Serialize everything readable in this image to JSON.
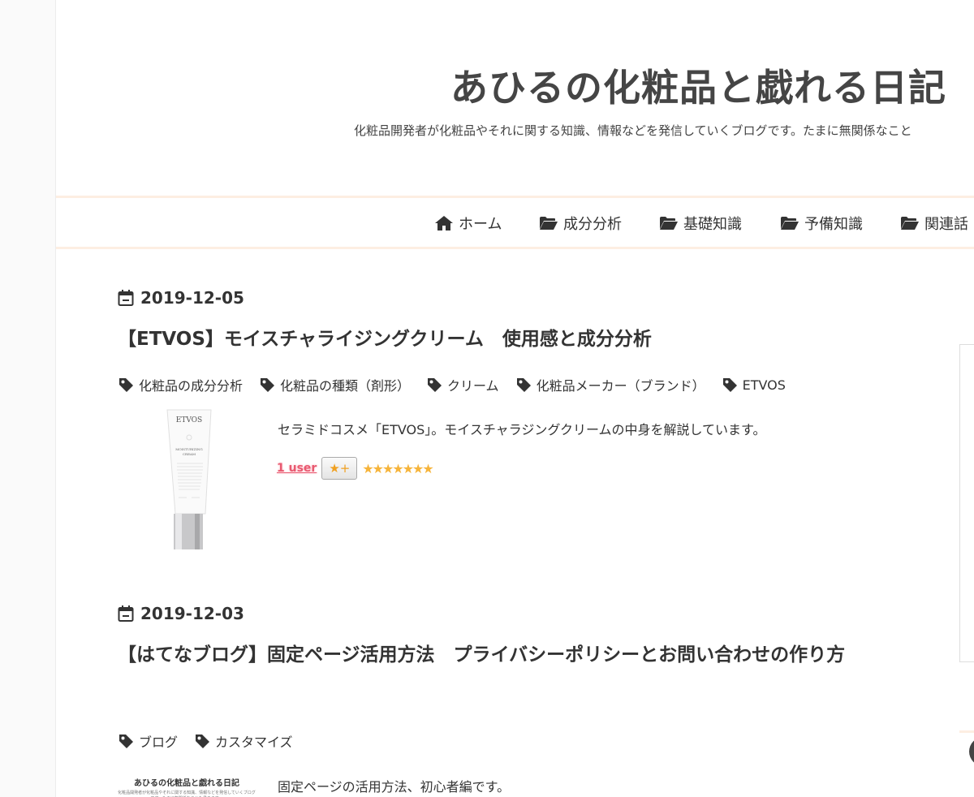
{
  "site": {
    "title": "あひるの化粧品と戯れる日記",
    "description": "化粧品開発者が化粧品やそれに関する知識、情報などを発信していくブログです。たまに無関係なこと"
  },
  "nav": [
    {
      "label": "ホーム",
      "icon": "home-icon"
    },
    {
      "label": "成分分析",
      "icon": "folder-open-icon"
    },
    {
      "label": "基礎知識",
      "icon": "folder-open-icon"
    },
    {
      "label": "予備知識",
      "icon": "folder-open-icon"
    },
    {
      "label": "関連話",
      "icon": "folder-open-icon"
    }
  ],
  "entries": [
    {
      "date": "2019-12-05",
      "title": "【ETVOS】モイスチャライジングクリーム　使用感と成分分析",
      "tags": [
        "化粧品の成分分析",
        "化粧品の種類（剤形）",
        "クリーム",
        "化粧品メーカー（ブランド）",
        "ETVOS"
      ],
      "summary": "セラミドコスメ「ETVOS」。モイスチャラジングクリームの中身を解説しています。",
      "bookmark_users": "1 user",
      "add_star": "★+",
      "stars": "★★★★★★★",
      "thumbnail": {
        "brand": "ETVOS",
        "sub": "MOISTURIZING",
        "product": "CREAM"
      }
    },
    {
      "date": "2019-12-03",
      "title": "【はてなブログ】固定ページ活用方法　プライバシーポリシーとお問い合わせの作り方",
      "tags": [
        "ブログ",
        "カスタマイズ"
      ],
      "summary": "固定ページの活用方法、初心者編です。",
      "thumbnail": {
        "title": "あひるの化粧品と戯れる日記",
        "desc": "化粧品開発者が化粧品やそれに関する知識、情報などを発信していくブログです。たまに無関係なことも書きます。"
      }
    }
  ],
  "colors": {
    "accent_border": "#fdeee2",
    "star": "#f6b43a",
    "users": "#e85a71",
    "text": "#333333"
  }
}
